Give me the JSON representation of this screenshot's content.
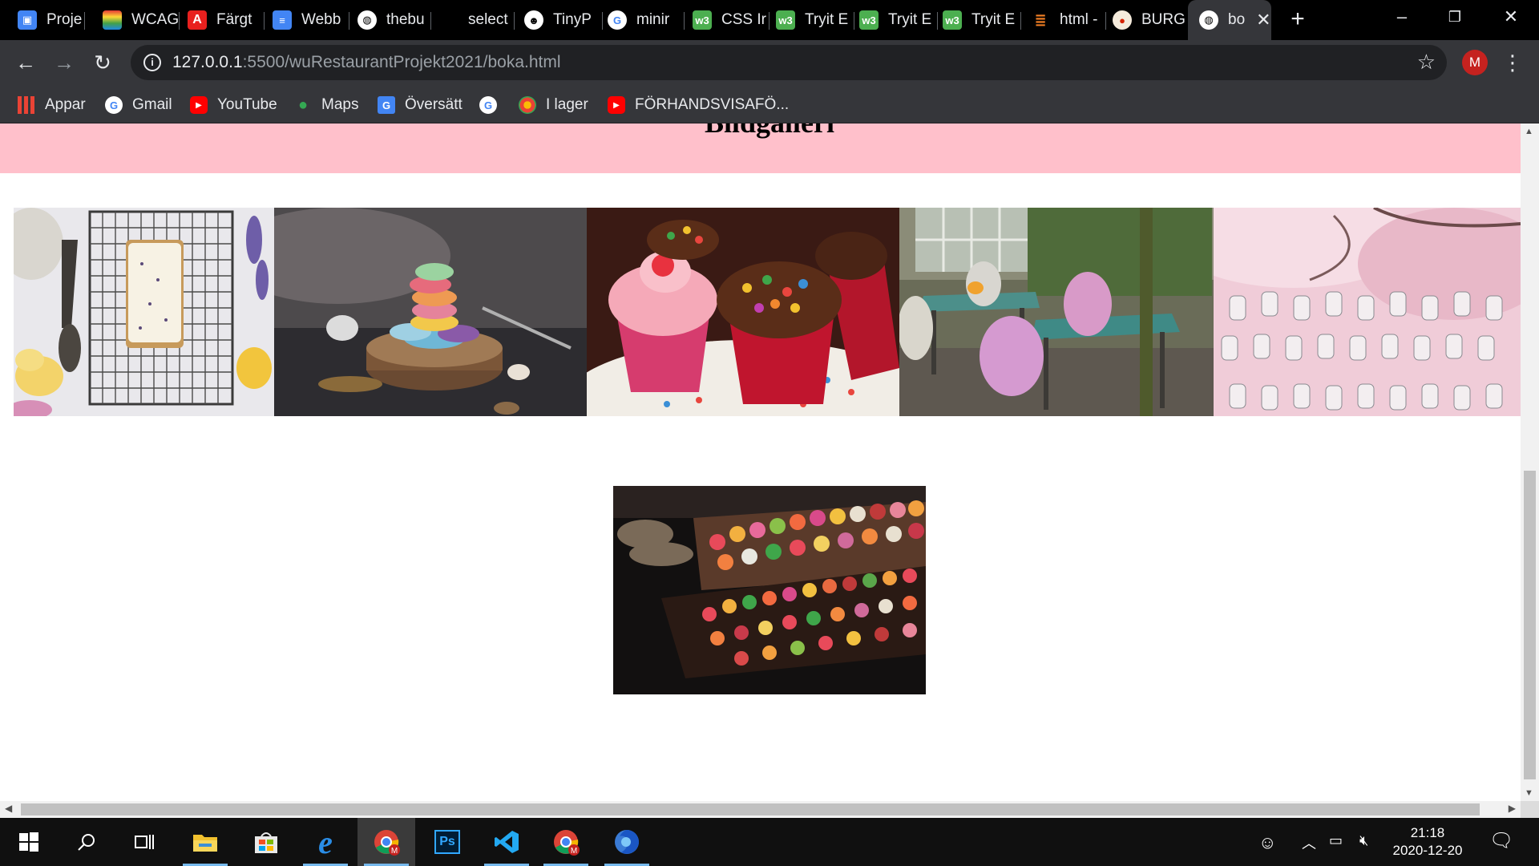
{
  "browser": {
    "tabs": [
      {
        "title": "Proje",
        "icon": "google-sites-icon",
        "color": "#4285f4"
      },
      {
        "title": "WCAG",
        "icon": "wcag-icon",
        "color": "#6a5acd"
      },
      {
        "title": "Färgt",
        "icon": "adobe-icon",
        "color": "#e8201e"
      },
      {
        "title": "Webb",
        "icon": "google-docs-icon",
        "color": "#4285f4"
      },
      {
        "title": "thebu",
        "icon": "globe-icon",
        "color": "#ffffff"
      },
      {
        "title": "select",
        "icon": "blank-icon",
        "color": "#000000"
      },
      {
        "title": "TinyP",
        "icon": "tinypng-panda-icon",
        "color": "#ffffff"
      },
      {
        "title": "minir",
        "icon": "google-icon",
        "color": "#ffffff"
      },
      {
        "title": "CSS Ir",
        "icon": "w3schools-icon",
        "color": "#4caf50"
      },
      {
        "title": "Tryit E",
        "icon": "w3schools-icon",
        "color": "#4caf50"
      },
      {
        "title": "Tryit E",
        "icon": "w3schools-icon",
        "color": "#4caf50"
      },
      {
        "title": "Tryit E",
        "icon": "w3schools-icon",
        "color": "#4caf50"
      },
      {
        "title": "html -",
        "icon": "stackoverflow-icon",
        "color": "#f48024"
      },
      {
        "title": "BURG",
        "icon": "burger-king-icon",
        "color": "#d62300"
      }
    ],
    "active_tab": {
      "title": "bo",
      "icon": "globe-icon"
    },
    "new_tab_label": "+",
    "window_controls": {
      "minimize": "–",
      "restore": "❐",
      "close": "✕"
    },
    "url_host": "127.0.0.1",
    "url_path": ":5500/wuRestaurantProjekt2021/boka.html",
    "profile_initial": "M",
    "bookmarks": [
      {
        "label": "Appar",
        "icon": "apps-grid-icon"
      },
      {
        "label": "Gmail",
        "icon": "google-icon"
      },
      {
        "label": "YouTube",
        "icon": "youtube-icon"
      },
      {
        "label": "Maps",
        "icon": "maps-pin-icon"
      },
      {
        "label": "Översätt",
        "icon": "google-translate-icon"
      },
      {
        "label": "",
        "icon": "google-icon"
      },
      {
        "label": "I lager",
        "icon": "chrome-extension-icon"
      },
      {
        "label": "FÖRHANDSVISAFÖ...",
        "icon": "youtube-icon"
      }
    ]
  },
  "page": {
    "heading": "Bildgalleri",
    "header_bg": "#ffc0cb",
    "gallery": [
      {
        "name": "lemon-loaf-cake"
      },
      {
        "name": "macarons-stack"
      },
      {
        "name": "candy-cupcakes"
      },
      {
        "name": "cafe-terrace-pink-chairs"
      },
      {
        "name": "cherry-blossom-lanterns"
      }
    ],
    "featured": {
      "name": "candy-market-stall"
    }
  },
  "taskbar": {
    "apps": [
      "windows-start-icon",
      "search-icon",
      "task-view-icon",
      "file-explorer-icon",
      "microsoft-store-icon",
      "edge-icon",
      "chrome-icon",
      "photoshop-icon",
      "vscode-icon",
      "chrome-icon",
      "firefox-icon"
    ],
    "time": "21:18",
    "date": "2020-12-20"
  }
}
